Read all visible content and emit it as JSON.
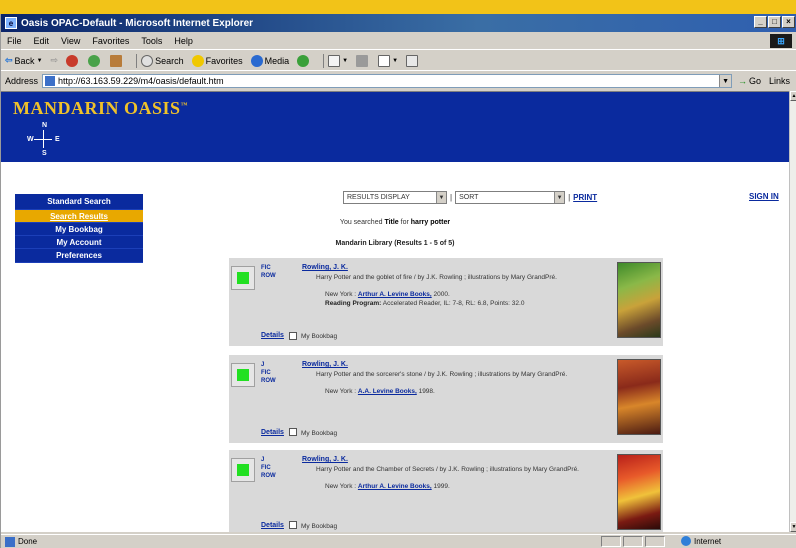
{
  "window": {
    "title": "Oasis OPAC-Default - Microsoft Internet Explorer"
  },
  "menu": [
    "File",
    "Edit",
    "View",
    "Favorites",
    "Tools",
    "Help"
  ],
  "toolbar": {
    "back": "Back",
    "search": "Search",
    "favorites": "Favorites",
    "media": "Media"
  },
  "address": {
    "label": "Address",
    "url": "http://63.163.59.229/m4/oasis/default.htm",
    "go": "Go",
    "links": "Links"
  },
  "banner": {
    "brand": "MANDARIN OASIS",
    "trademark": "™",
    "compass": {
      "n": "N",
      "s": "S",
      "w": "W",
      "e": "E"
    }
  },
  "nav": {
    "items": [
      {
        "label": "Standard Search",
        "active": false
      },
      {
        "label": "Search Results",
        "active": true
      },
      {
        "label": "My Bookbag",
        "active": false
      },
      {
        "label": "My Account",
        "active": false
      },
      {
        "label": "Preferences",
        "active": false
      }
    ]
  },
  "controls": {
    "results_display": "RESULTS DISPLAY",
    "sort": "SORT",
    "print": "PRINT",
    "sign_in": "SIGN IN"
  },
  "search_info": {
    "prefix": "You searched",
    "field": "Title",
    "for_text": "for",
    "query": "harry potter",
    "library_line": "Mandarin Library (Results 1 - 5 of 5)"
  },
  "results": [
    {
      "codes": [
        "FIC",
        "ROW"
      ],
      "author": "Rowling, J. K.",
      "description": "Harry Potter and the goblet of fire / by J.K. Rowling ; illustrations by Mary GrandPré.",
      "pub_place": "New York :",
      "publisher": "Arthur A. Levine Books,",
      "year": "2000.",
      "reading_label": "Reading Program:",
      "reading_value": "Accelerated Reader, IL: 7-8, RL: 6.8, Points: 32.0",
      "details": "Details",
      "bookbag": "My Bookbag"
    },
    {
      "codes": [
        "J",
        "FIC",
        "ROW"
      ],
      "author": "Rowling, J. K.",
      "description": "Harry Potter and the sorcerer's stone / by J.K. Rowling ; illustrations by Mary GrandPré.",
      "pub_place": "New York :",
      "publisher": "A.A. Levine Books,",
      "year": "1998.",
      "details": "Details",
      "bookbag": "My Bookbag"
    },
    {
      "codes": [
        "J",
        "FIC",
        "ROW"
      ],
      "author": "Rowling, J. K.",
      "description": "Harry Potter and the Chamber of Secrets / by J.K. Rowling ; illustrations by Mary GrandPré.",
      "pub_place": "New York :",
      "publisher": "Arthur A. Levine Books,",
      "year": "1999.",
      "details": "Details",
      "bookbag": "My Bookbag"
    }
  ],
  "status": {
    "text": "Done",
    "zone": "Internet"
  },
  "colors": {
    "banner": "#0a2a9e",
    "brand": "#f0c22a",
    "nav_active": "#e8a800",
    "result_bg": "#d9d9d9",
    "link": "#0a2a9e",
    "available_indicator": "#22e022"
  }
}
